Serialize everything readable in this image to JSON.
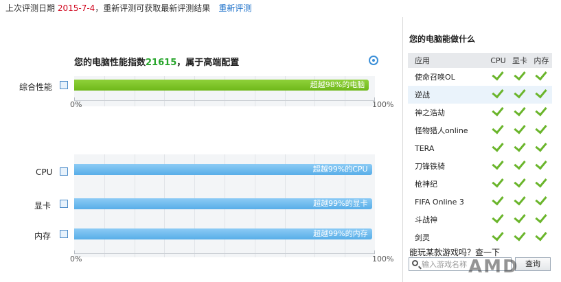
{
  "header": {
    "prefix": "上次评测日期 ",
    "date": "2015-7-4",
    "suffix": "，重新评测可获取最新评测结果",
    "retest_link": "重新评测"
  },
  "score": {
    "title_prefix": "您的电脑性能指数",
    "value": "21615",
    "title_suffix": "，属于高端配置"
  },
  "overall": {
    "label": "综合性能",
    "percent": 98,
    "bar_text": "超越98%的电脑",
    "axis_min": "0%",
    "axis_max": "100%"
  },
  "components": [
    {
      "label": "CPU",
      "percent": 99,
      "bar_text": "超越99%的CPU"
    },
    {
      "label": "显卡",
      "percent": 99,
      "bar_text": "超越99%的显卡"
    },
    {
      "label": "内存",
      "percent": 99,
      "bar_text": "超越99%的内存"
    }
  ],
  "components_axis": {
    "min": "0%",
    "max": "100%"
  },
  "sidebar": {
    "title": "您的电脑能做什么",
    "columns": [
      "应用",
      "CPU",
      "显卡",
      "内存"
    ],
    "games": [
      "使命召唤OL",
      "逆战",
      "神之浩劫",
      "怪物猎人online",
      "TERA",
      "刀锋铁骑",
      "枪神纪",
      "FIFA Online 3",
      "斗战神",
      "剑灵"
    ],
    "question": "能玩某款游戏吗？查一下",
    "search_placeholder": "输入游戏名称",
    "search_button": "查询"
  },
  "logo_text": "AMD",
  "colors": {
    "overall_bar": "#7cc526",
    "component_bar": "#6ab9ec",
    "check": "#6ab52b",
    "date": "#d0021b",
    "link": "#1a6fc9"
  }
}
